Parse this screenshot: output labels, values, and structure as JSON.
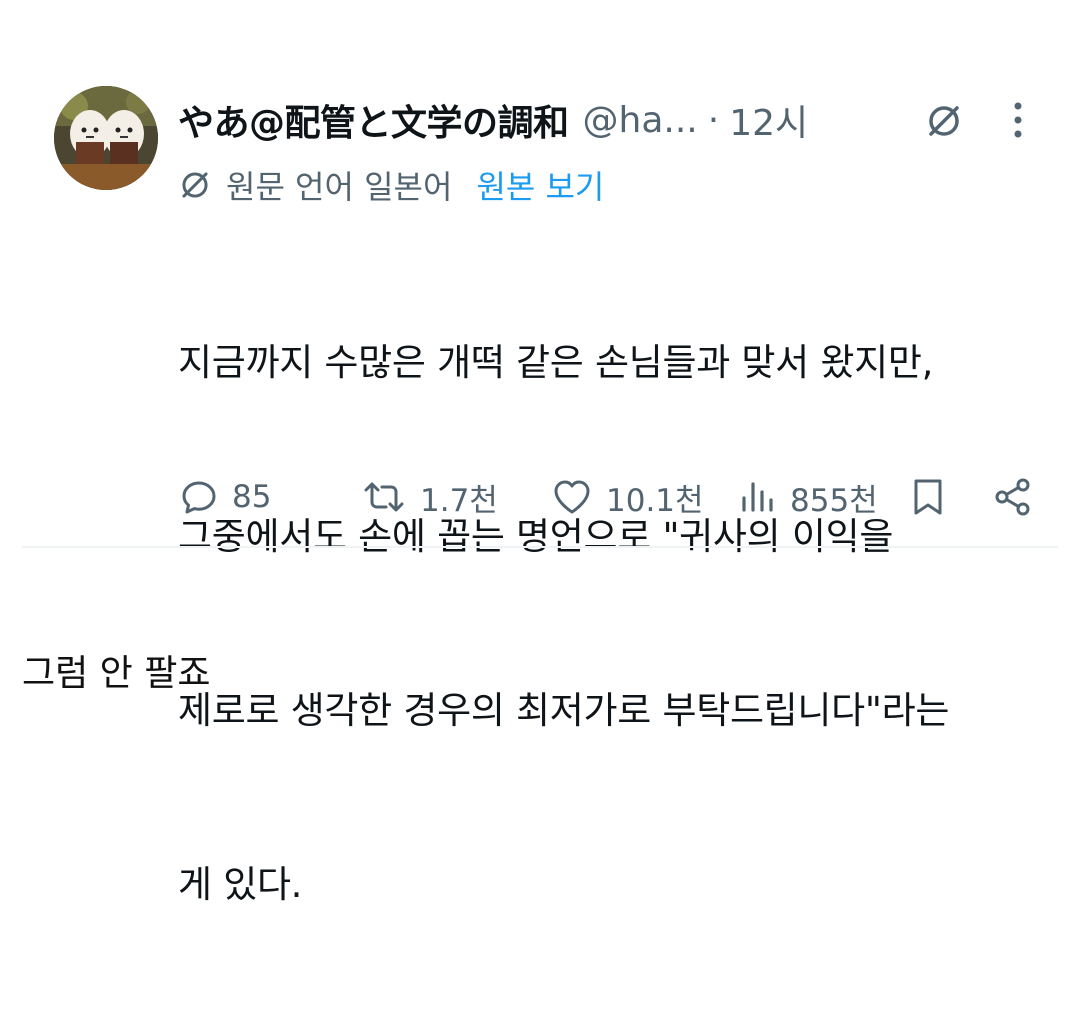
{
  "tweet": {
    "display_name": "やあ@配管と文学の調和",
    "handle": "@ha...",
    "separator": "·",
    "time": "12시",
    "avatar_icon": "avatar-image",
    "grok_icon": "grok-icon",
    "more_icon": "more-vertical-icon",
    "translation": {
      "icon": "grok-icon",
      "original_language_text": "원문 언어 일본어",
      "show_original_link": "원본 보기",
      "link_color": "#1d9bf0"
    },
    "text_lines": [
      "지금까지 수많은 개떡 같은 손님들과 맞서 왔지만,",
      "그중에서도 손에 꼽는 명언으로 \"귀사의 이익을",
      "제로로 생각한 경우의 최저가로 부탁드립니다\"라는",
      "게 있다."
    ],
    "actions": {
      "reply_count": "85",
      "retweet_count": "1.7천",
      "like_count": "10.1천",
      "view_count": "855천"
    }
  },
  "caption": "그럼 안 팔죠",
  "colors": {
    "text_primary": "#0f1419",
    "text_secondary": "#536471",
    "accent": "#1d9bf0",
    "divider": "#eff3f4"
  }
}
